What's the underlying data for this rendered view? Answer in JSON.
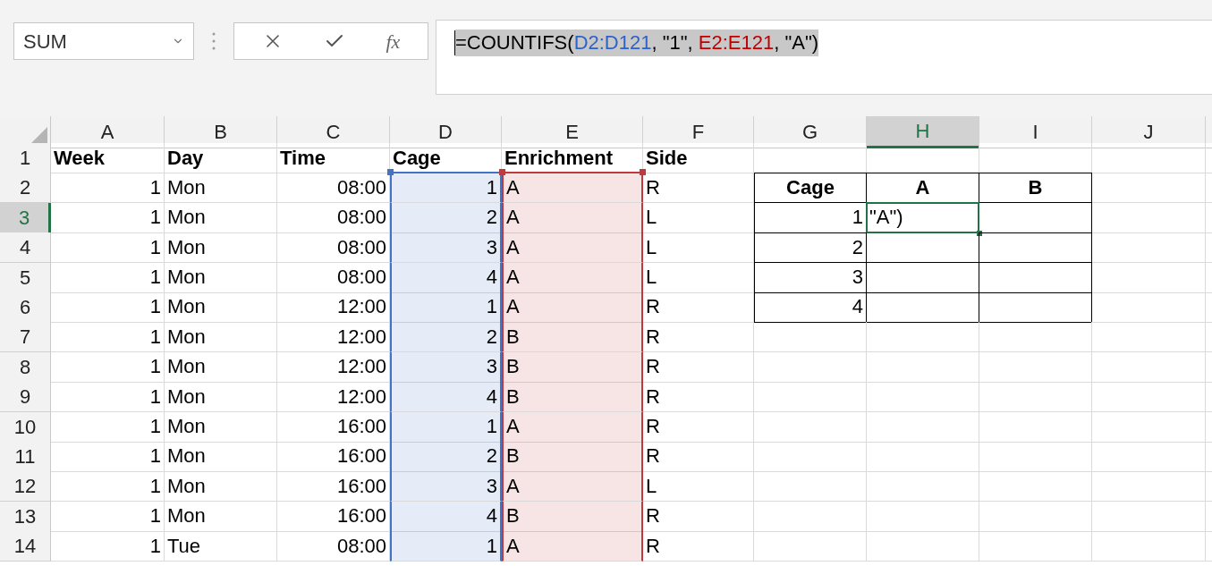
{
  "name_box": {
    "value": "SUM"
  },
  "formula_buttons": [
    "fx"
  ],
  "formula": [
    {
      "text": "=COUNTIFS(",
      "color": "#000000"
    },
    {
      "text": "D2:D121",
      "color": "#2f62c9"
    },
    {
      "text": ", \"1\", ",
      "color": "#000000"
    },
    {
      "text": "E2:E121",
      "color": "#c00000"
    },
    {
      "text": ", \"A\")",
      "color": "#000000"
    }
  ],
  "columns": [
    {
      "label": "A",
      "selected": false
    },
    {
      "label": "B",
      "selected": false
    },
    {
      "label": "C",
      "selected": false
    },
    {
      "label": "D",
      "selected": false,
      "color": "#4472c4"
    },
    {
      "label": "E",
      "selected": false,
      "color": "#c0393b"
    },
    {
      "label": "F",
      "selected": false
    },
    {
      "label": "G",
      "selected": false
    },
    {
      "label": "H",
      "selected": true
    },
    {
      "label": "I",
      "selected": false
    },
    {
      "label": "J",
      "selected": false
    }
  ],
  "rows": [
    {
      "label": "1",
      "selected": false,
      "bold": true,
      "cells": [
        "Week",
        "Day",
        "Time",
        "Cage",
        "Enrichment",
        "Side"
      ]
    },
    {
      "label": "2",
      "selected": false,
      "cells": [
        "1",
        "Mon",
        "08:00",
        "1",
        "A",
        "R"
      ]
    },
    {
      "label": "3",
      "selected": true,
      "cells": [
        "1",
        "Mon",
        "08:00",
        "2",
        "A",
        "L"
      ]
    },
    {
      "label": "4",
      "selected": false,
      "cells": [
        "1",
        "Mon",
        "08:00",
        "3",
        "A",
        "L"
      ]
    },
    {
      "label": "5",
      "selected": false,
      "cells": [
        "1",
        "Mon",
        "08:00",
        "4",
        "A",
        "L"
      ]
    },
    {
      "label": "6",
      "selected": false,
      "cells": [
        "1",
        "Mon",
        "12:00",
        "1",
        "A",
        "R"
      ]
    },
    {
      "label": "7",
      "selected": false,
      "cells": [
        "1",
        "Mon",
        "12:00",
        "2",
        "B",
        "R"
      ]
    },
    {
      "label": "8",
      "selected": false,
      "cells": [
        "1",
        "Mon",
        "12:00",
        "3",
        "B",
        "R"
      ]
    },
    {
      "label": "9",
      "selected": false,
      "cells": [
        "1",
        "Mon",
        "12:00",
        "4",
        "B",
        "R"
      ]
    },
    {
      "label": "10",
      "selected": false,
      "cells": [
        "1",
        "Mon",
        "16:00",
        "1",
        "A",
        "R"
      ]
    },
    {
      "label": "11",
      "selected": false,
      "cells": [
        "1",
        "Mon",
        "16:00",
        "2",
        "B",
        "R"
      ]
    },
    {
      "label": "12",
      "selected": false,
      "cells": [
        "1",
        "Mon",
        "16:00",
        "3",
        "A",
        "L"
      ]
    },
    {
      "label": "13",
      "selected": false,
      "cells": [
        "1",
        "Mon",
        "16:00",
        "4",
        "B",
        "R"
      ]
    },
    {
      "label": "14",
      "selected": false,
      "cells": [
        "1",
        "Tue",
        "08:00",
        "1",
        "A",
        "R"
      ]
    }
  ],
  "summary_table": {
    "header": [
      "Cage",
      "A",
      "B"
    ],
    "rows": [
      [
        {
          "text": "1",
          "selected": false
        },
        {
          "text": "\"A\")",
          "selected": true
        },
        {
          "selected": false
        }
      ],
      [
        {
          "text": "2",
          "selected": false
        },
        {
          "selected": false
        },
        {
          "selected": false
        }
      ],
      [
        {
          "text": "3",
          "selected": false
        },
        {
          "selected": false
        },
        {
          "selected": false
        }
      ],
      [
        {
          "text": "4",
          "selected": false
        },
        {
          "selected": false
        },
        {
          "selected": false
        }
      ]
    ]
  }
}
